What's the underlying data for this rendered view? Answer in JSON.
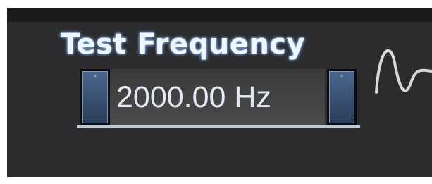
{
  "test_frequency": {
    "title": "Test Frequency",
    "value": "2000.00 Hz",
    "decrement_icon": "chevron-down-icon",
    "increment_icon": "chevron-up-icon",
    "waveform_icon": "sine-wave-icon"
  },
  "colors": {
    "panel_background": "#2c2c2e",
    "title_text": "#eef6ff",
    "title_glow": "#5e8fd0",
    "stepper_button": "#3b5478",
    "value_text": "#e3eaf4"
  }
}
